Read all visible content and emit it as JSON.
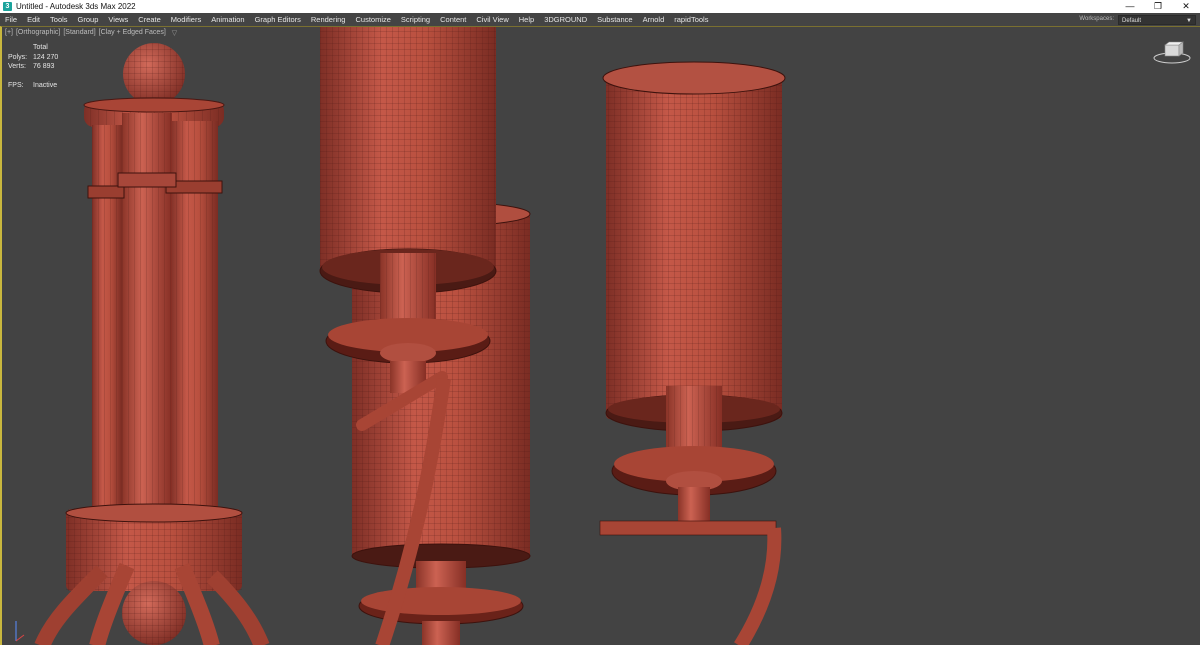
{
  "title": "Untitled - Autodesk 3ds Max 2022",
  "app_icon_letter": "3",
  "window_controls": [
    "—",
    "❐",
    "✕"
  ],
  "menu": [
    "File",
    "Edit",
    "Tools",
    "Group",
    "Views",
    "Create",
    "Modifiers",
    "Animation",
    "Graph Editors",
    "Rendering",
    "Customize",
    "Scripting",
    "Content",
    "Civil View",
    "Help",
    "3DGROUND",
    "Substance",
    "Arnold",
    "rapidTools"
  ],
  "workspaces": {
    "label": "Workspaces:",
    "value": "Default"
  },
  "viewport": {
    "labels": [
      "[+]",
      "[Orthographic]",
      "[Standard]",
      "[Clay + Edged Faces]"
    ],
    "stats": {
      "header": "Total",
      "polys_label": "Polys:",
      "polys": "124 270",
      "verts_label": "Verts:",
      "verts": "76 893",
      "fps_label": "FPS:",
      "fps": "Inactive"
    }
  },
  "colors": {
    "clay": "#b24c3e",
    "viewport_bg": "#444444",
    "active_border": "#c9b73e"
  }
}
